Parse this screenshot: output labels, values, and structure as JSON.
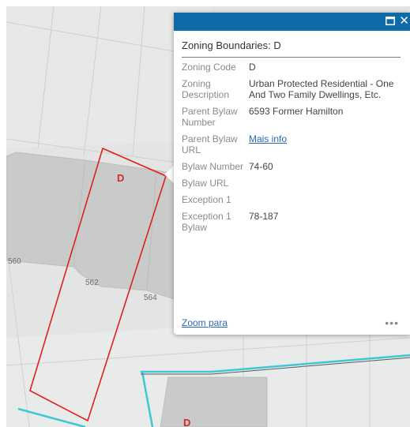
{
  "popup": {
    "title": "Zoning Boundaries: D",
    "fields": [
      {
        "key": "Zoning Code",
        "value": "D"
      },
      {
        "key": "Zoning Description",
        "value": "Urban Protected Residential - One And Two Family Dwellings, Etc."
      },
      {
        "key": "Parent Bylaw Number",
        "value": "6593 Former Hamilton"
      },
      {
        "key": "Parent Bylaw URL",
        "value": "Mais info",
        "is_link": true
      },
      {
        "key": "Bylaw Number",
        "value": "74-60"
      },
      {
        "key": "Bylaw URL",
        "value": ""
      },
      {
        "key": "Exception 1",
        "value": ""
      },
      {
        "key": "Exception 1 Bylaw",
        "value": "78-187"
      }
    ],
    "zoom_label": "Zoom para",
    "more_label": "•••",
    "header_colour": "#0e6ba8"
  },
  "map": {
    "zone_label": "D",
    "zone_label_bottom": "D",
    "parcel_numbers": [
      "560",
      "562",
      "564"
    ],
    "selection_colour": "#e02020",
    "boundary_colour": "#3ec8d6"
  }
}
